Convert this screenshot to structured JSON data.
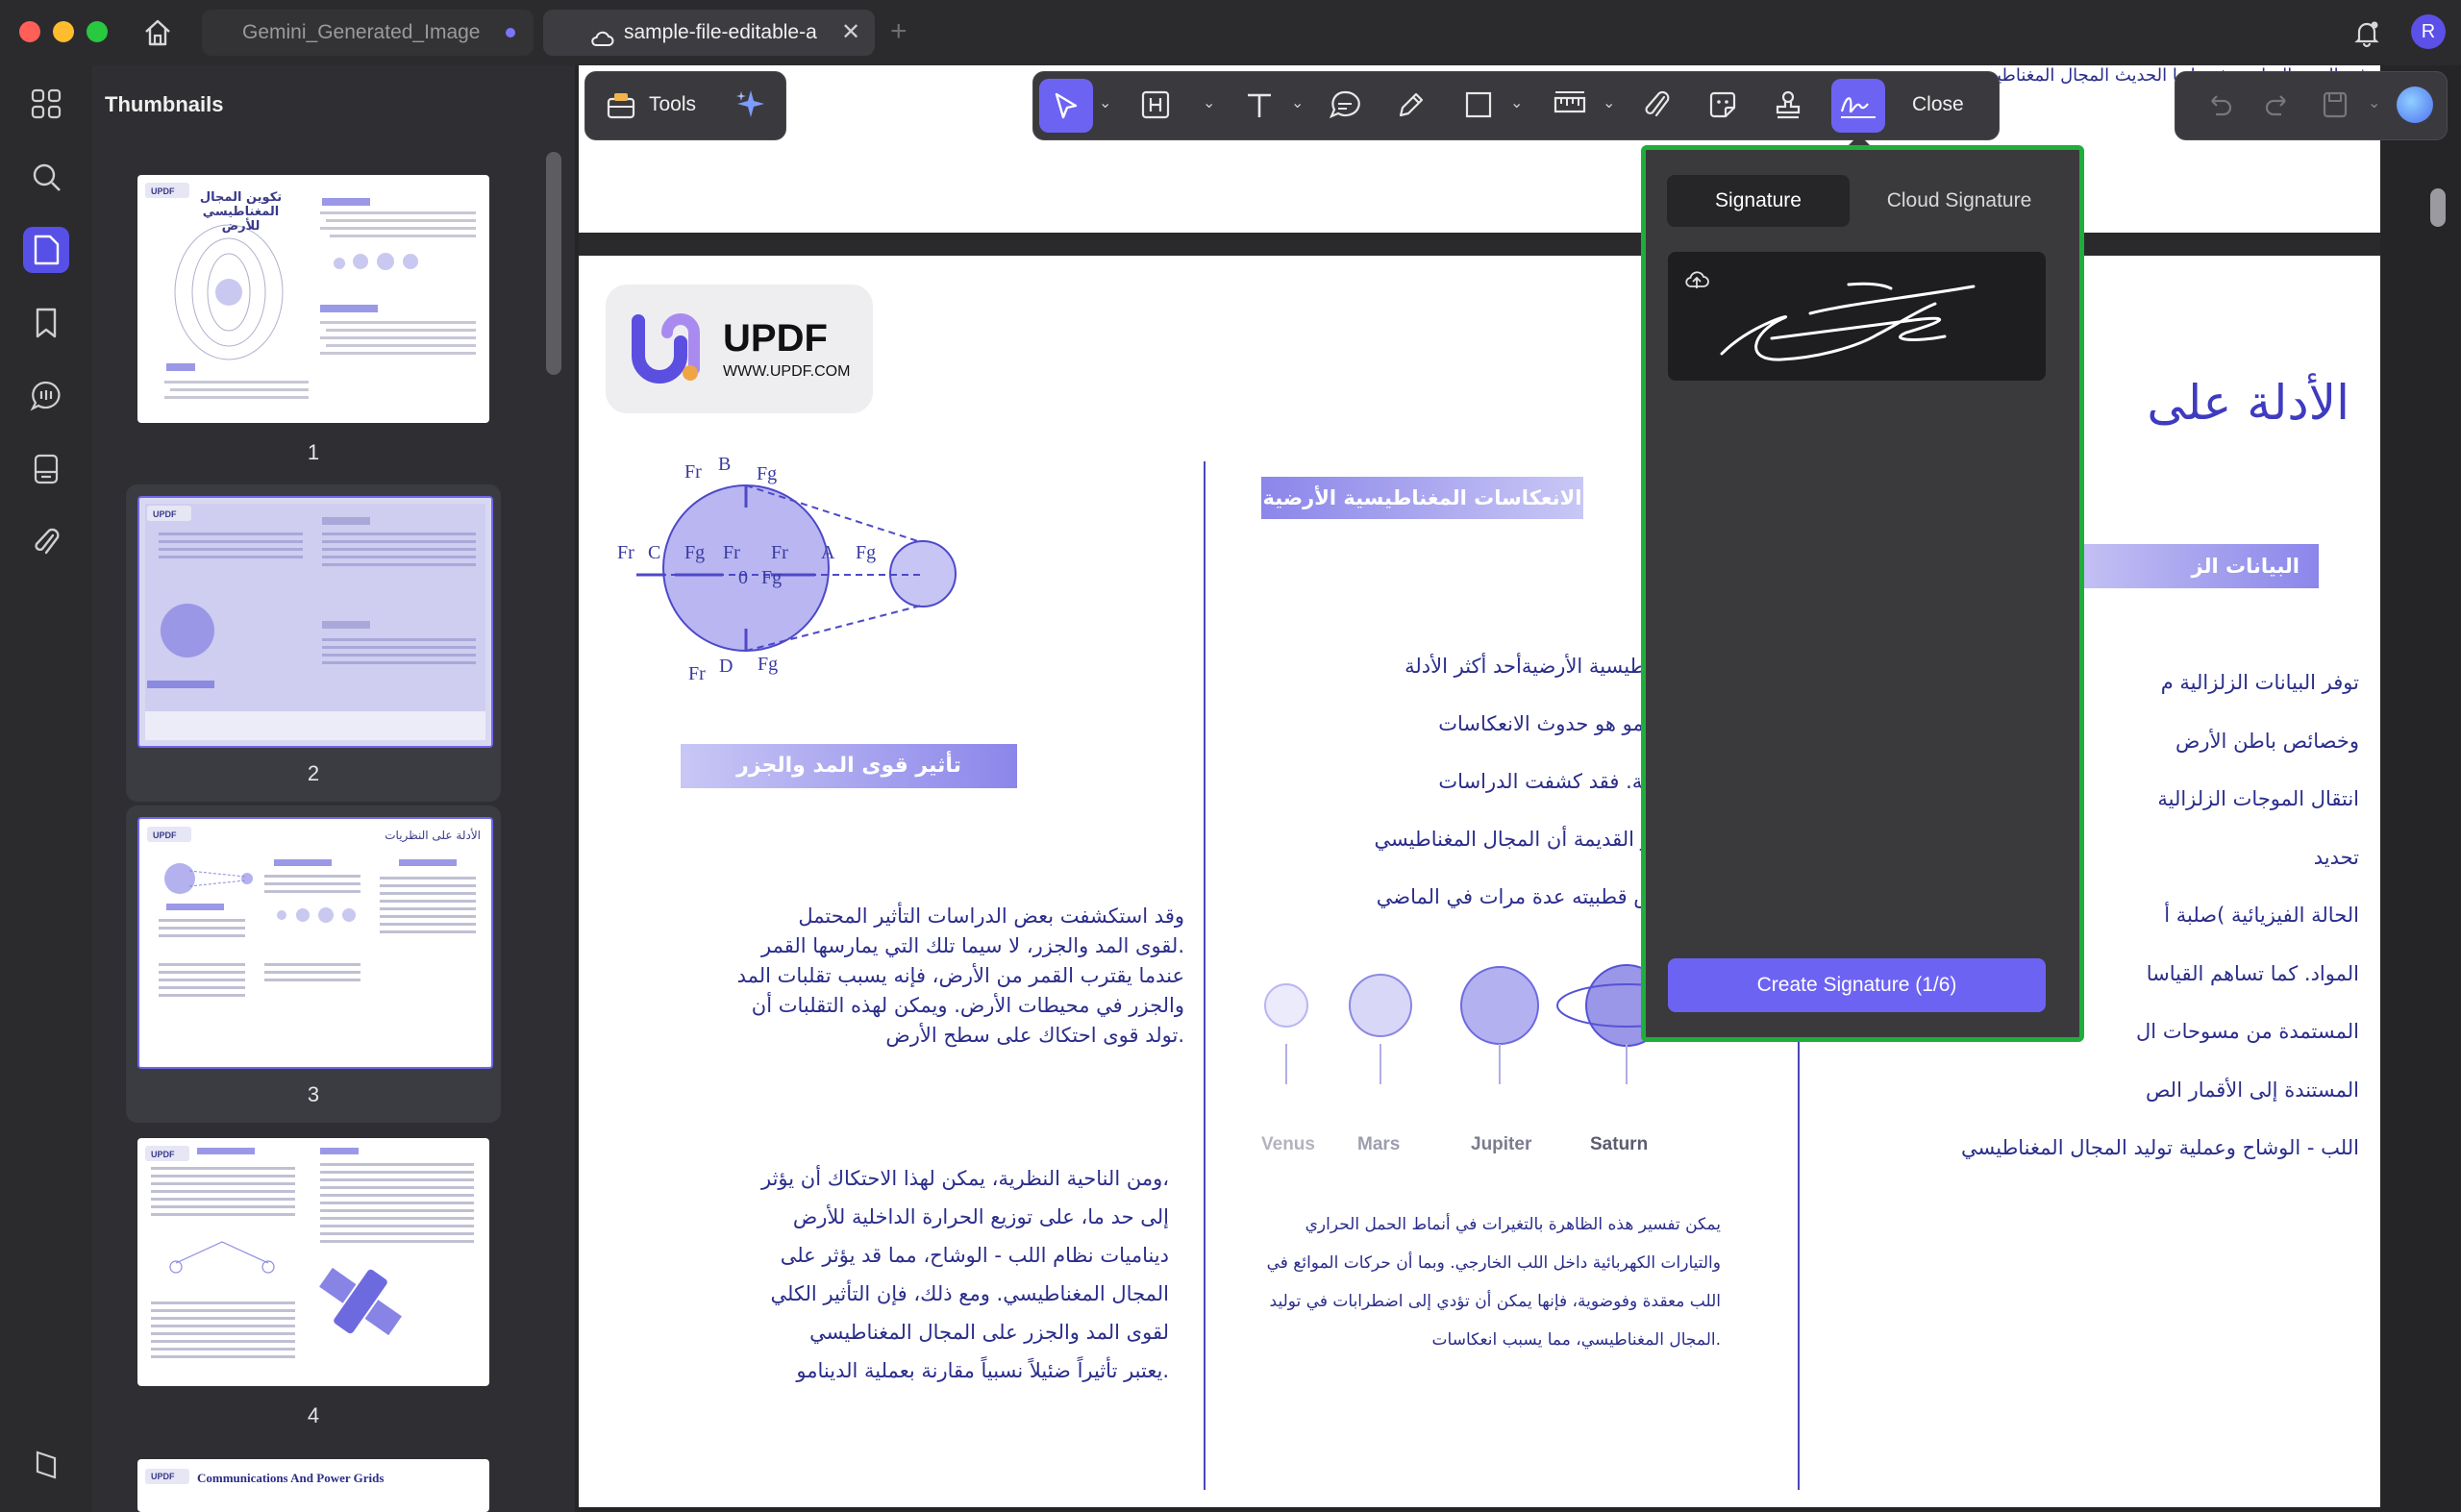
{
  "tabs": [
    {
      "label": "Gemini_Generated_Image",
      "modified": true
    },
    {
      "label": "sample-file-editable-a",
      "active": true
    }
  ],
  "user_avatar": "R",
  "sidebar": {
    "title": "Thumbnails"
  },
  "thumbnails": [
    {
      "page": "1",
      "heading": "تكوين المجال المغناطيسي للأرض"
    },
    {
      "page": "2"
    },
    {
      "page": "3",
      "heading": "الأدلة على النظريات"
    },
    {
      "page": "4"
    },
    {
      "page": "",
      "heading": "Communications And Power Grids"
    }
  ],
  "toolbar": {
    "tools_label": "Tools",
    "close_label": "Close"
  },
  "signature_panel": {
    "tab_signature": "Signature",
    "tab_cloud": "Cloud Signature",
    "create_button": "Create Signature (1/6)"
  },
  "document": {
    "top_partial": "في القرن السابع عشر، إنها الحديث المجال المغناطيسي",
    "logo_name": "UPDF",
    "logo_url": "WWW.UPDF.COM",
    "main_heading": "الأدلة على",
    "diagram_labels": {
      "fr": "Fr",
      "fg": "Fg",
      "b": "B",
      "c": "C",
      "a": "A",
      "d": "D",
      "zero": "0"
    },
    "tidal_heading": "تأثير قوى المد والجزر",
    "tidal_p1": [
      "وقد استكشفت بعض الدراسات التأثير المحتمل",
      ".لقوى المد والجزر، لا سيما تلك التي يمارسها القمر",
      "عندما يقترب القمر من الأرض، فإنه يسبب تقلبات المد",
      "والجزر في محيطات الأرض. ويمكن لهذه التقلبات أن",
      ".تولد قوى احتكاك على سطح الأرض"
    ],
    "tidal_p2": [
      "،ومن الناحية النظرية، يمكن لهذا الاحتكاك أن يؤثر",
      "إلى حد ما، على توزيع الحرارة الداخلية للأرض",
      "ديناميات نظام اللب - الوشاح، مما قد يؤثر على",
      "المجال المغناطيسي. ومع ذلك، فإن التأثير الكلي",
      "لقوى المد والجزر على المجال المغناطيسي",
      ".يعتبر تأثيراً ضئيلاً نسبياً مقارنة بعملية الدينامو"
    ],
    "reversal_heading": "الانعكاسات المغناطيسية الأرضية",
    "reversal_lines": [
      "سات المغناطيسية الأرضيةأحد أكثر الأدلة",
      "نظرية الدينامو هو حدوث الانعكاسات",
      "يسية الأرضية. فقد كشفت الدراسات",
      "جية للصخور القديمة أن المجال المغناطيسي",
      "ض قد عكس قطبيته عدة مرات في الماضي"
    ],
    "planets": [
      "Venus",
      "Mars",
      "Jupiter",
      "Saturn"
    ],
    "bottom_paragraph": [
      "يمكن تفسير هذه الظاهرة بالتغيرات في أنماط الحمل الحراري",
      "والتيارات الكهربائية داخل اللب الخارجي. وبما أن حركات الموائع في",
      "اللب معقدة وفوضوية، فإنها يمكن أن تؤدي إلى اضطرابات في توليد",
      ".المجال المغناطيسي، مما يسبب انعكاسات"
    ],
    "seismic_heading": "البيانات الز",
    "seismic_lines": [
      "توفر البيانات الزلزالية م",
      "وخصائص باطن الأرض",
      "انتقال الموجات الزلزالية",
      "تحديد",
      "الحالة الفيزيائية )صلبة أ",
      "المواد. كما تساهم القياسا",
      "المستمدة من مسوحات ال",
      "المستندة إلى الأقمار الص",
      "اللب - الوشاح وعملية توليد المجال المغناطيسي"
    ]
  }
}
